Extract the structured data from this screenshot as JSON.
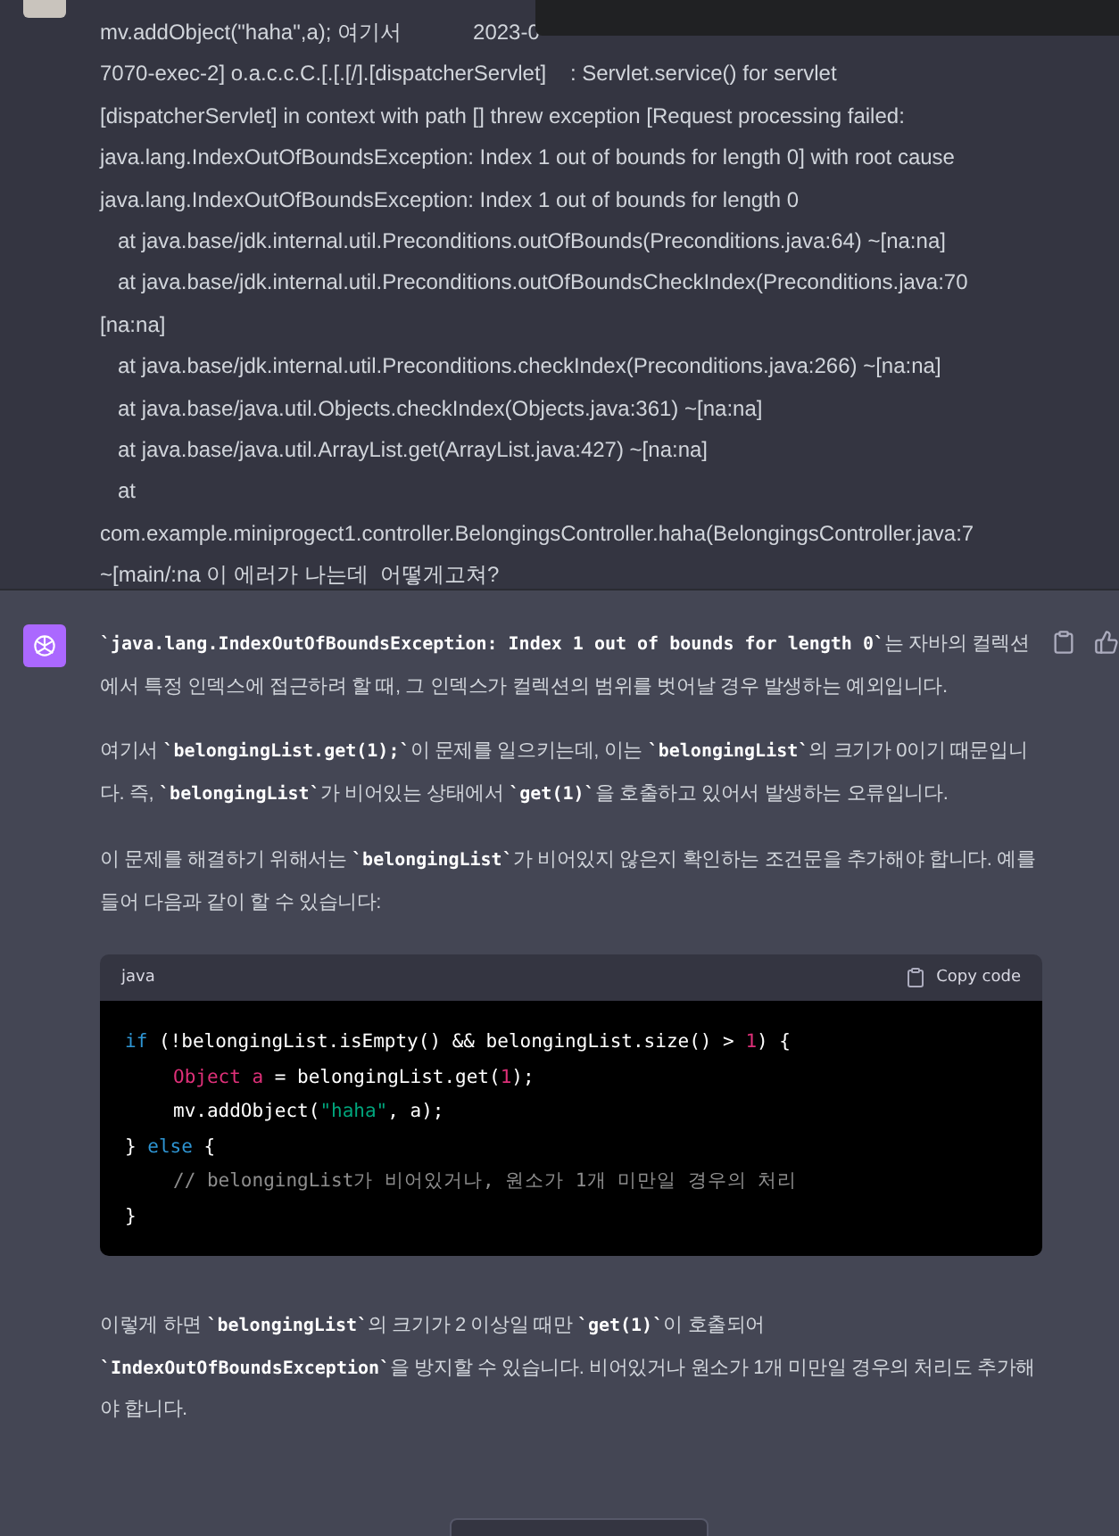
{
  "user_message": {
    "paragraphs": [
      [
        {
          "text": "mv.addObject(\"haha\",a); 여기서",
          "tail": "2023-0"
        },
        {
          "text": "7070-exec-2] o.a.c.c.C.[.[.[/].[dispatcherServlet]    : Servlet.service() for servlet"
        },
        {
          "text": "[dispatcherServlet] in context with path [] threw exception [Request processing failed:"
        },
        {
          "text": "java.lang.IndexOutOfBoundsException: Index 1 out of bounds for length 0] with root cause"
        }
      ],
      [
        {
          "text": "java.lang.IndexOutOfBoundsException: Index 1 out of bounds for length 0"
        },
        {
          "text": "   at java.base/jdk.internal.util.Preconditions.outOfBounds(Preconditions.java:64) ~[na:na]"
        },
        {
          "text": "   at java.base/jdk.internal.util.Preconditions.outOfBoundsCheckIndex(Preconditions.java:70"
        },
        {
          "text": "[na:na]"
        },
        {
          "text": "   at java.base/jdk.internal.util.Preconditions.checkIndex(Preconditions.java:266) ~[na:na]"
        },
        {
          "text": "   at java.base/java.util.Objects.checkIndex(Objects.java:361) ~[na:na]"
        },
        {
          "text": "   at java.base/java.util.ArrayList.get(ArrayList.java:427) ~[na:na]"
        },
        {
          "text": "   at"
        },
        {
          "text": "com.example.miniprogect1.controller.BelongingsController.haha(BelongingsController.java:7"
        },
        {
          "text": "~[main/:na 이 에러가 나는데  어떻게고쳐?"
        }
      ]
    ]
  },
  "assistant_message": {
    "paragraphs": [
      "**`java.lang.IndexOutOfBoundsException: Index 1 out of bounds for length 0`**는 자바의 컬렉션에서 특정 인덱스에 접근하려 할 때, 그 인덱스가 컬렉션의 범위를 벗어날 경우 발생하는 예외입니다.",
      "여기서 **`belongingList.get(1);`**이 문제를 일으키는데, 이는 **`belongingList`**의 크기가 0이기 때문입니다. 즉, **`belongingList`**가 비어있는 상태에서 **`get(1)`**을 호출하고 있어서 발생하는 오류입니다.",
      "이 문제를 해결하기 위해서는 **`belongingList`**가 비어있지 않은지 확인하는 조건문을 추가해야 합니다. 예를 들어 다음과 같이 할 수 있습니다:"
    ],
    "code_block": {
      "language": "java",
      "copy_label": "Copy code",
      "lines": [
        {
          "indented": false,
          "tokens": [
            {
              "t": "if",
              "kind": "keyword"
            },
            {
              "t": " (!belongingList.isEmpty() && belongingList.size() > ",
              "kind": "plain"
            },
            {
              "t": "1",
              "kind": "number"
            },
            {
              "t": ") {",
              "kind": "plain"
            }
          ]
        },
        {
          "indented": true,
          "tokens": [
            {
              "t": "Object a",
              "kind": "type"
            },
            {
              "t": " = belongingList.get(",
              "kind": "plain"
            },
            {
              "t": "1",
              "kind": "number"
            },
            {
              "t": ");",
              "kind": "plain"
            }
          ]
        },
        {
          "indented": true,
          "tokens": [
            {
              "t": "mv.addObject(",
              "kind": "plain"
            },
            {
              "t": "\"haha\"",
              "kind": "string"
            },
            {
              "t": ", a);",
              "kind": "plain"
            }
          ]
        },
        {
          "indented": false,
          "tokens": [
            {
              "t": "} ",
              "kind": "plain"
            },
            {
              "t": "else",
              "kind": "keyword"
            },
            {
              "t": " {",
              "kind": "plain"
            }
          ]
        },
        {
          "indented": true,
          "tokens": [
            {
              "t": "// belongingList가 비어있거나, 원소가 1개 미만일 경우의 처리",
              "kind": "comment"
            }
          ]
        },
        {
          "indented": false,
          "tokens": [
            {
              "t": "}",
              "kind": "plain"
            }
          ]
        }
      ]
    },
    "after": "이렇게 하면 **`belongingList`**의 크기가 2 이상일 때만 **`get(1)`**이 호출되어 **`IndexOutOfBoundsException`**을 방지할 수 있습니다. 비어있거나 원소가 1개 미만일 경우의 처리도 추가해야 합니다."
  }
}
